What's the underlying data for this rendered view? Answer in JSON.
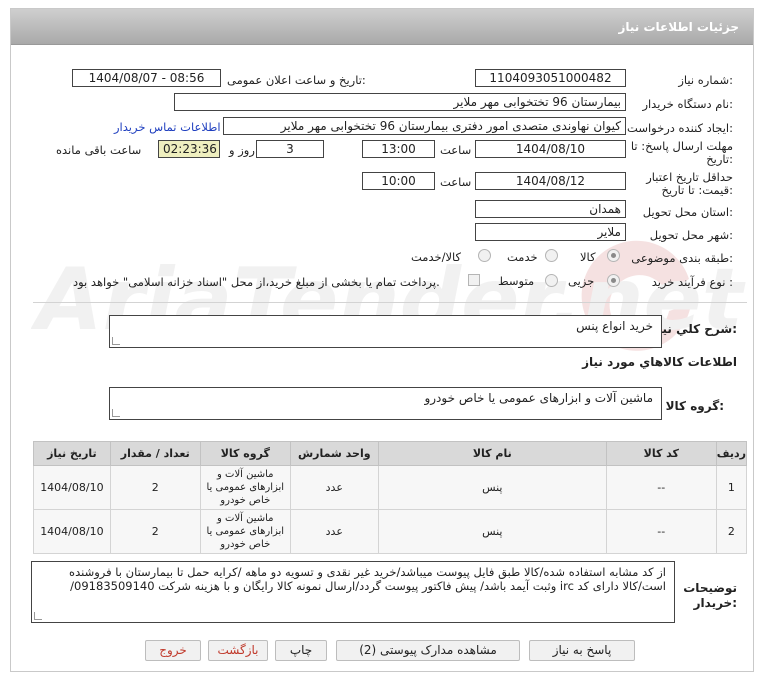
{
  "header": {
    "title": "جزئیات اطلاعات نیاز"
  },
  "need_number": {
    "label": "شماره نیاز:",
    "value": "1104093051000482"
  },
  "announce": {
    "label": "تاریخ و ساعت اعلان عمومی:",
    "value": "1404/08/07 - 08:56"
  },
  "buyer": {
    "label": "نام دستگاه خریدار:",
    "value": "بیمارستان 96 تختخوابی مهر ملایر"
  },
  "creator": {
    "label": "ایجاد کننده درخواست:",
    "value": "کیوان نهاوندی متصدی امور دفتری بیمارستان 96 تختخوابی مهر ملایر",
    "contact_link": "اطلاعات تماس خریدار"
  },
  "reply_deadline": {
    "label1": "مهلت ارسال پاسخ: تا",
    "label2": "تاریخ:",
    "date": "1404/08/10",
    "time_label": "ساعت",
    "time": "13:00",
    "days": "3",
    "days_label": "روز و",
    "remaining": "02:23:36",
    "remaining_label": "ساعت باقی مانده"
  },
  "price_validity": {
    "label1": "حداقل تاریخ اعتبار",
    "label2": "قیمت: تا تاریخ:",
    "date": "1404/08/12",
    "time_label": "ساعت",
    "time": "10:00"
  },
  "province": {
    "label": "استان محل تحویل:",
    "value": "همدان"
  },
  "city": {
    "label": "شهر محل تحویل:",
    "value": "ملایر"
  },
  "category": {
    "label": "طبقه بندی موضوعی:",
    "options": [
      "کالا",
      "خدمت",
      "کالا/خدمت"
    ],
    "selected": "کالا"
  },
  "process": {
    "label": "نوع فرآیند خرید :",
    "options": [
      "جزیی",
      "متوسط"
    ],
    "selected": "جزیی",
    "payment_note": "پرداخت تمام یا بخشی از مبلغ خرید،از محل \"اسناد خزانه اسلامی\" خواهد بود."
  },
  "summary": {
    "label": "شرح کلي نياز:",
    "value": "خرید انواع پنس"
  },
  "goods_title": "اطلاعات کالاهاي مورد نياز",
  "goods_group": {
    "label": "گروه کالا:",
    "value": "ماشین آلات و ابزارهای عمومی یا خاص خودرو"
  },
  "table": {
    "headers": [
      "ردیف",
      "کد کالا",
      "نام کالا",
      "واحد شمارش",
      "گروه کالا",
      "تعداد / مقدار",
      "تاریخ نیاز"
    ],
    "rows": [
      {
        "idx": "1",
        "code": "--",
        "name": "پنس",
        "unit": "عدد",
        "group": "ماشین آلات و ابزارهای عمومی یا خاص خودرو",
        "qty": "2",
        "date": "1404/08/10"
      },
      {
        "idx": "2",
        "code": "--",
        "name": "پنس",
        "unit": "عدد",
        "group": "ماشین آلات و ابزارهای عمومی یا خاص خودرو",
        "qty": "2",
        "date": "1404/08/10"
      }
    ]
  },
  "buyer_notes": {
    "label1": "توضیحات",
    "label2": "خریدار:",
    "value": "از کد مشابه استفاده شده/کالا طبق فایل پیوست  میباشد/خرید غیر نقدی و تسویه دو ماهه  /کرایه حمل تا بیمارستان با فروشنده است/کالا دارای کد irc  وثبت آیمد باشد/ پیش فاکتور پیوست گردد/ارسال نمونه کالا رایگان و با هزینه شرکت 09183509140/"
  },
  "buttons": {
    "reply": "پاسخ به نیاز",
    "docs": "مشاهده مدارک پیوستی (2)",
    "print": "چاپ",
    "back": "بازگشت",
    "exit": "خروج"
  },
  "watermark": "AriaTender.net",
  "colors": {
    "header_bg": "#b4b4b4",
    "remaining_bg": "#efefbf",
    "link": "#1f3fbf",
    "back_text": "#c0392b",
    "exit_text": "#c0392b"
  }
}
